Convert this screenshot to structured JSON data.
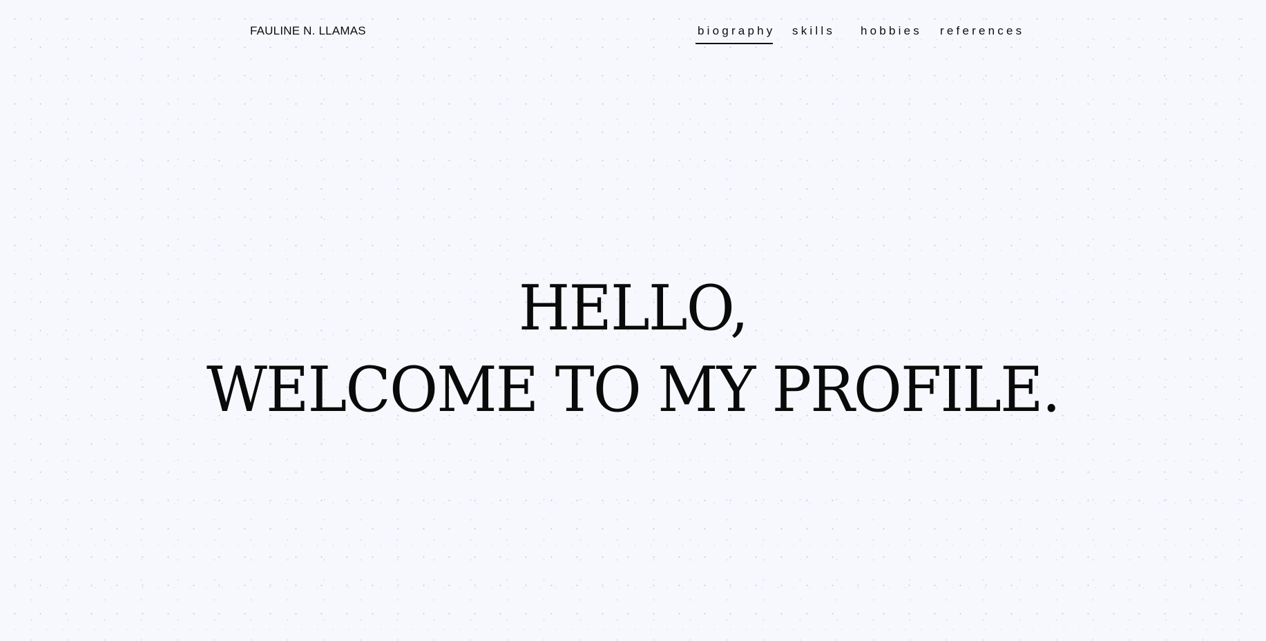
{
  "header": {
    "site_name": "FAULINE N. LLAMAS"
  },
  "nav": {
    "items": [
      {
        "label": "biography",
        "active": true
      },
      {
        "label": "skills",
        "active": false
      },
      {
        "label": "hobbies",
        "active": false
      },
      {
        "label": "references",
        "active": false
      }
    ]
  },
  "hero": {
    "line1": "HELLO,",
    "line2": "WELCOME TO MY PROFILE."
  },
  "colors": {
    "background": "#f7f8fe",
    "text": "#0c0c0c"
  }
}
